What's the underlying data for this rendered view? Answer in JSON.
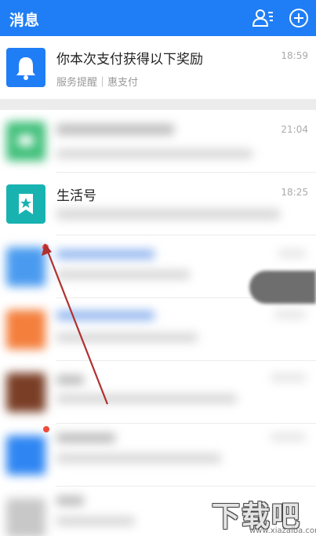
{
  "header": {
    "title": "消息",
    "contacts_icon": "contacts-icon",
    "add_icon": "plus-circle-icon"
  },
  "messages": [
    {
      "name": "你本次支付获得以下奖励",
      "sub": "服务提醒｜惠支付",
      "time": "18:59",
      "icon": "bell-icon",
      "color": "#1f7ef6"
    },
    {
      "name": "",
      "sub": "",
      "time": "21:04",
      "icon": "chat-bubble-icon",
      "color": "#3fbf79"
    },
    {
      "name": "生活号",
      "sub": "",
      "time": "18:25",
      "icon": "star-bookmark-icon",
      "color": "#18b3b1"
    }
  ],
  "watermark": {
    "text": "下载吧",
    "url": "www.xiazaiba.com"
  },
  "colors": {
    "header_bg": "#1f7ef6",
    "annotation_arrow": "#b0302f"
  }
}
